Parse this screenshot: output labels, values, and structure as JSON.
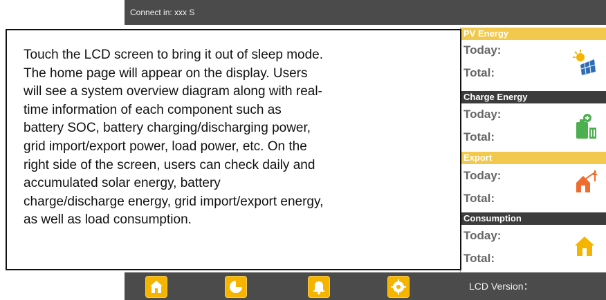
{
  "device": {
    "topbar_text": "Connect in: xxx S",
    "lcd_version_label": "LCD Version："
  },
  "sections": [
    {
      "title": "PV Energy",
      "today_label": "Today:",
      "total_label": "Total:",
      "icon": "solar-panel-icon",
      "header_color": "#f2c94c"
    },
    {
      "title": "Charge Energy",
      "today_label": "Today:",
      "total_label": "Total:",
      "icon": "battery-charge-icon",
      "header_color": "#3c3c3c"
    },
    {
      "title": "Export",
      "today_label": "Today:",
      "total_label": "Total:",
      "icon": "grid-export-icon",
      "header_color": "#f2c94c"
    },
    {
      "title": "Consumption",
      "today_label": "Today:",
      "total_label": "Total:",
      "icon": "house-icon",
      "header_color": "#3c3c3c"
    }
  ],
  "bottom_nav": [
    {
      "name": "home-nav-button",
      "icon": "home-icon",
      "selected": true
    },
    {
      "name": "stats-nav-button",
      "icon": "pie-chart-icon",
      "selected": false
    },
    {
      "name": "alarm-nav-button",
      "icon": "bell-icon",
      "selected": false
    },
    {
      "name": "settings-nav-button",
      "icon": "gear-icon",
      "selected": false
    }
  ],
  "overlay": {
    "text": "Touch the LCD screen to bring it out of sleep mode.\nThe home page will appear on the display. Users\nwill see a system overview diagram along with real-\ntime information of each component such as\nbattery SOC, battery charging/discharging power,\ngrid import/export power, load power, etc. On the\nright side of the screen, users can check daily and\naccumulated solar energy, battery\ncharge/discharge energy, grid import/export energy,\nas well as load consumption."
  },
  "colors": {
    "bar_gray": "#4b4b4b",
    "accent_yellow": "#f2c94c",
    "nav_orange": "#f5b400",
    "label_gray": "#666666"
  }
}
